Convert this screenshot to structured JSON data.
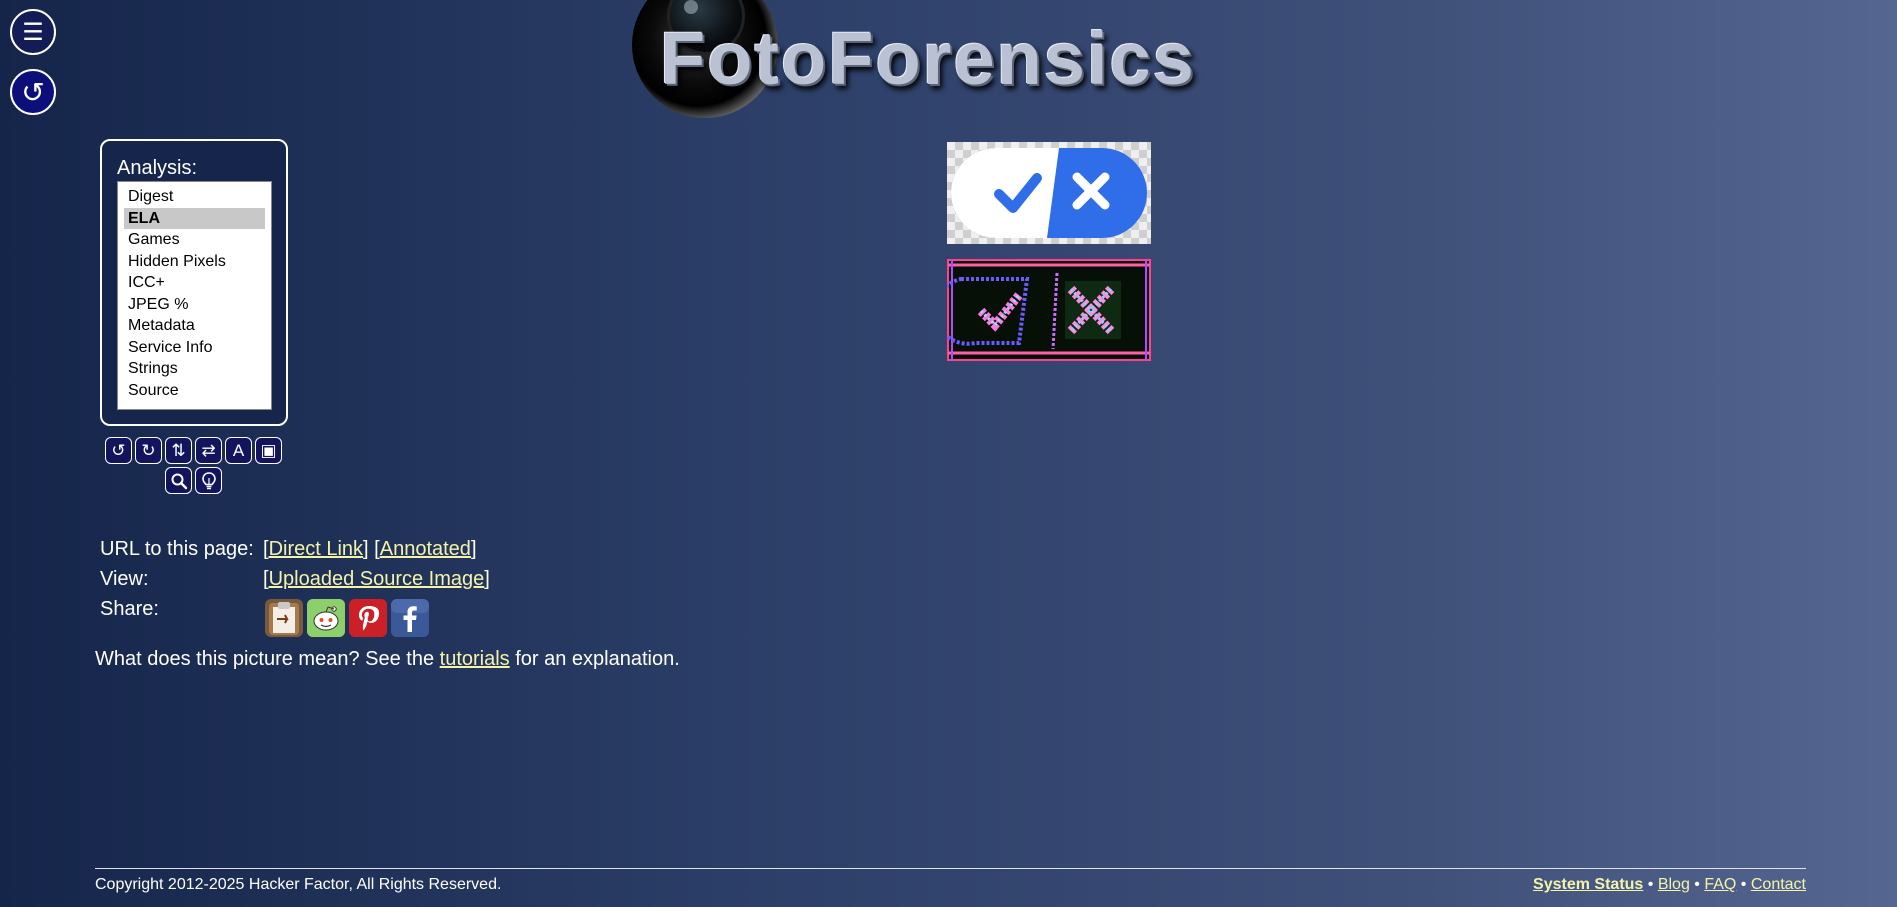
{
  "nav": {
    "menu_icon": "☰",
    "reload_icon": "↺"
  },
  "logo": {
    "text": "FotoForensics"
  },
  "analysis": {
    "title": "Analysis:",
    "items": [
      "Digest",
      "ELA",
      "Games",
      "Hidden Pixels",
      "ICC+",
      "JPEG %",
      "Metadata",
      "Service Info",
      "Strings",
      "Source"
    ],
    "selected": "ELA"
  },
  "tools": [
    {
      "name": "rotate-left-icon",
      "glyph": "↺"
    },
    {
      "name": "rotate-right-icon",
      "glyph": "↻"
    },
    {
      "name": "flip-vertical-icon",
      "glyph": "⇅"
    },
    {
      "name": "flip-horizontal-icon",
      "glyph": "⇄"
    },
    {
      "name": "text-icon",
      "glyph": "A"
    },
    {
      "name": "frame-icon",
      "glyph": "▣"
    },
    {
      "name": "magnifier-icon",
      "glyph": "🔍"
    },
    {
      "name": "lightbulb-icon",
      "glyph": "💡"
    }
  ],
  "info": {
    "url_label": "URL to this page:",
    "direct_link": "Direct Link",
    "annotated": "Annotated",
    "view_label": "View:",
    "uploaded_source": "Uploaded Source Image",
    "share_label": "Share:",
    "open_bracket": "[",
    "close_bracket": "]",
    "explain_before": "What does this picture mean? See the ",
    "tutorials": "tutorials",
    "explain_after": " for an explanation."
  },
  "share": [
    "clipboard-icon",
    "reddit-icon",
    "pinterest-icon",
    "facebook-icon"
  ],
  "footer": {
    "copyright": "Copyright 2012-2025 Hacker Factor, All Rights Reserved.",
    "system_status": "System Status",
    "blog": "Blog",
    "faq": "FAQ",
    "contact": "Contact",
    "separator": " • "
  },
  "colors": {
    "link": "#f4f3a9",
    "toggle_blue": "#2f6ee8"
  }
}
